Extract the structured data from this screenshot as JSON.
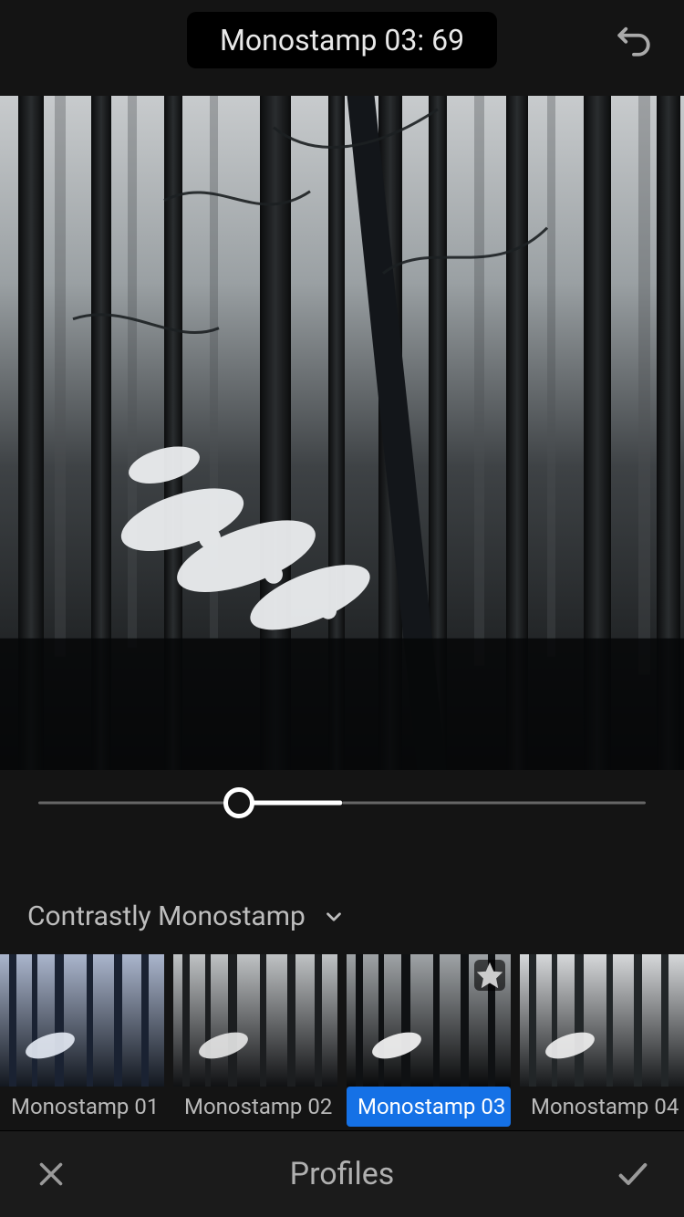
{
  "header": {
    "preset_label": "Monostamp 03: 69"
  },
  "slider": {
    "value": 69,
    "min": 0,
    "center": 50,
    "max": 200,
    "track_left_pct": 31,
    "fill_start_pct": 33,
    "fill_end_pct": 50,
    "track_right_start_pct": 50
  },
  "group": {
    "name": "Contrastly Monostamp"
  },
  "presets": [
    {
      "label": "Monostamp 01",
      "selected": false,
      "tint": "cool",
      "starred": false
    },
    {
      "label": "Monostamp 02",
      "selected": false,
      "tint": "neutral",
      "starred": false
    },
    {
      "label": "Monostamp 03",
      "selected": true,
      "tint": "dark",
      "starred": true
    },
    {
      "label": "Monostamp 04",
      "selected": false,
      "tint": "light",
      "starred": false
    }
  ],
  "bottom": {
    "title": "Profiles"
  },
  "icons": {
    "undo": "undo-icon",
    "chevron_down": "chevron-down-icon",
    "close": "close-icon",
    "check": "check-icon",
    "star": "star-icon"
  },
  "colors": {
    "accent": "#1571e6",
    "bg": "#141414"
  }
}
